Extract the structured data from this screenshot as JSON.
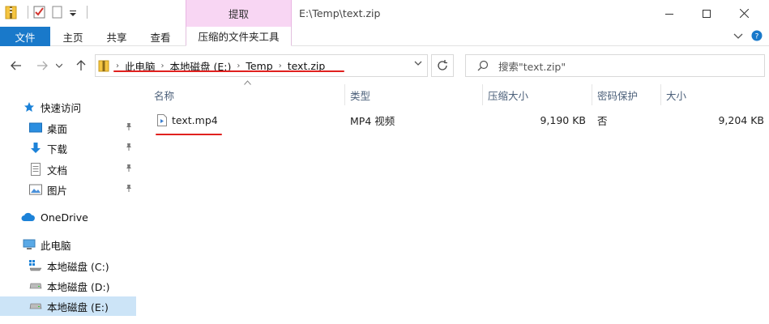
{
  "window": {
    "title": "E:\\Temp\\text.zip",
    "context_tab": "提取"
  },
  "ribbon": {
    "tabs": [
      "文件",
      "主页",
      "共享",
      "查看",
      "压缩的文件夹工具"
    ]
  },
  "address": {
    "crumbs": [
      "此电脑",
      "本地磁盘 (E:)",
      "Temp",
      "text.zip"
    ]
  },
  "search": {
    "placeholder": "搜索\"text.zip\""
  },
  "sidebar": {
    "quick_access": "快速访问",
    "items": [
      {
        "label": "桌面",
        "icon": "desktop-icon",
        "pinned": true
      },
      {
        "label": "下载",
        "icon": "download-icon",
        "pinned": true
      },
      {
        "label": "文档",
        "icon": "document-icon",
        "pinned": true
      },
      {
        "label": "图片",
        "icon": "picture-icon",
        "pinned": true
      }
    ],
    "onedrive": "OneDrive",
    "this_pc": "此电脑",
    "drives": [
      "本地磁盘 (C:)",
      "本地磁盘 (D:)",
      "本地磁盘 (E:)"
    ]
  },
  "table": {
    "headers": [
      "名称",
      "类型",
      "压缩大小",
      "密码保护",
      "大小"
    ],
    "rows": [
      {
        "name": "text.mp4",
        "type": "MP4 视频",
        "compressed": "9,190 KB",
        "password": "否",
        "size": "9,204 KB"
      }
    ]
  },
  "colors": {
    "accent": "#1979ca",
    "context_tab": "#f8d6f3",
    "selection": "#cce4f7",
    "annotation": "#e0211f"
  }
}
